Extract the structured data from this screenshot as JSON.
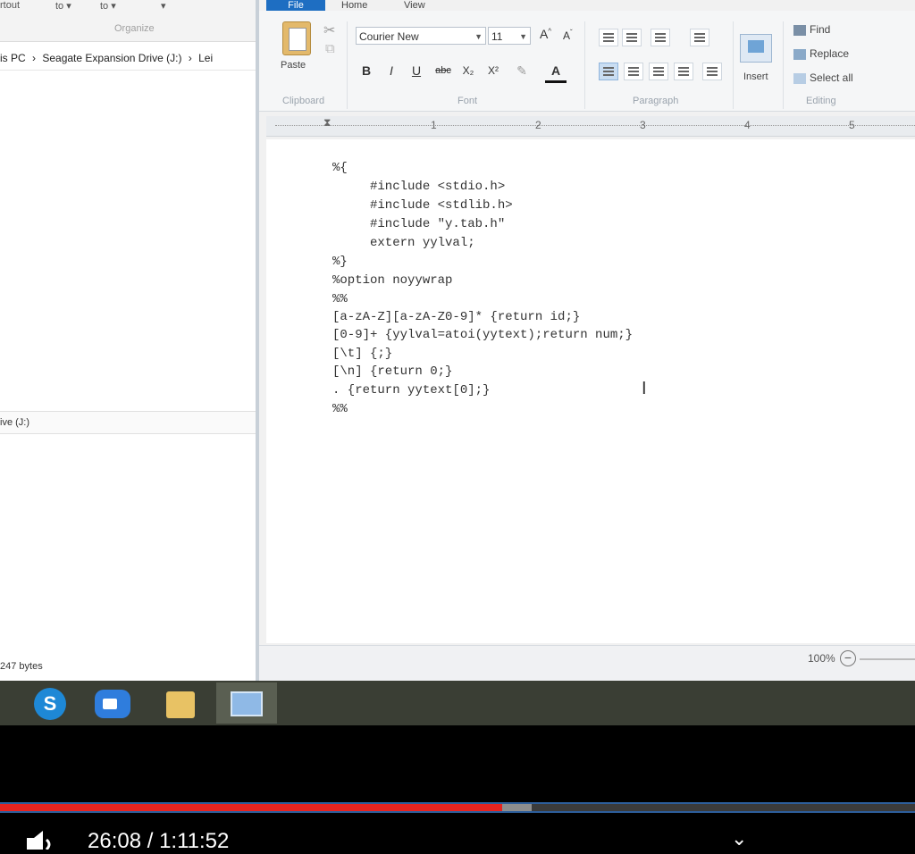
{
  "explorer": {
    "ribbon_buttons": [
      "rtout",
      "to ▾",
      "to ▾",
      "▾"
    ],
    "ribbon_group": "Organize",
    "address": [
      "is PC",
      "›",
      "Seagate Expansion Drive (J:)",
      "›",
      "Lei"
    ],
    "nav_item": "ive (J:)",
    "status": "247 bytes"
  },
  "wordpad": {
    "tabs": {
      "file": "File",
      "home": "Home",
      "view": "View"
    },
    "clipboard": {
      "paste": "Paste",
      "label": "Clipboard"
    },
    "font": {
      "name": "Courier New",
      "size": "11",
      "label": "Font",
      "buttons": [
        "B",
        "I",
        "U",
        "abc",
        "X₂",
        "X²",
        "✎",
        "A"
      ]
    },
    "paragraph": {
      "label": "Paragraph"
    },
    "insert": {
      "label": "Insert"
    },
    "editing": {
      "label": "Editing",
      "find": "Find",
      "replace": "Replace",
      "select_all": "Select all"
    },
    "ruler_marks": [
      "1",
      "2",
      "3",
      "4",
      "5"
    ],
    "document_lines": [
      "%{",
      "     #include <stdio.h>",
      "     #include <stdlib.h>",
      "     #include \"y.tab.h\"",
      "     extern yylval;",
      "%}",
      "%option noyywrap",
      "%%",
      "[a-zA-Z][a-zA-Z0-9]* {return id;}",
      "[0-9]+ {yylval=atoi(yytext);return num;}",
      "[\\t] {;}",
      "[\\n] {return 0;}",
      ". {return yytext[0];}",
      "%%"
    ],
    "zoom": "100%",
    "zoom_out": "−"
  },
  "taskbar": {
    "skype_letter": "S"
  },
  "player": {
    "time": "26:08 / 1:11:52",
    "progress": 0.549,
    "buffered": 0.581,
    "chevron": "⌄"
  },
  "colors": {
    "accent_file_tab": "#1e6ec2",
    "progress": "#e6241f",
    "taskbar": "#3a3e34"
  }
}
